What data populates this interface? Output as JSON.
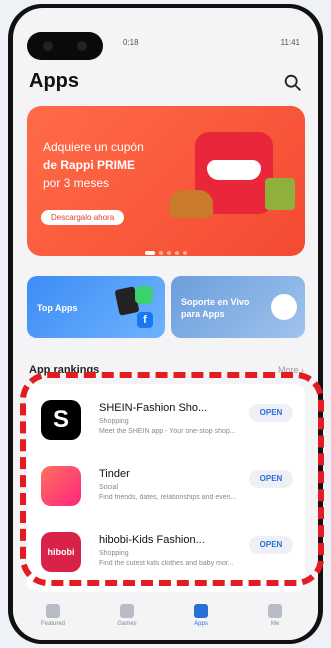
{
  "status": {
    "time_left": "0:18",
    "right": "11:41"
  },
  "header": {
    "title": "Apps"
  },
  "banner": {
    "line1": "Adquiere un cupón",
    "line2": "de Rappi PRIME",
    "line3": "por 3 meses",
    "cta": "Descargalo ahora"
  },
  "cards": [
    {
      "label": "Top Apps"
    },
    {
      "label": "Soporte en Vivo para Apps"
    }
  ],
  "rankings": {
    "title": "App rankings",
    "more": "More ›",
    "items": [
      {
        "name": "SHEIN-Fashion Sho...",
        "category": "Shopping",
        "desc": "Meet the SHEIN app - Your one-stop shop...",
        "action": "OPEN",
        "icon": "shein-icon",
        "letter": "S"
      },
      {
        "name": "Tinder",
        "category": "Social",
        "desc": "Find friends, dates, relationships and even...",
        "action": "OPEN",
        "icon": "tinder-icon",
        "letter": ""
      },
      {
        "name": "hibobi-Kids Fashion...",
        "category": "Shopping",
        "desc": "Find the cutest kids clothes and baby mor...",
        "action": "OPEN",
        "icon": "hibobi-icon",
        "letter": "hibobi"
      }
    ]
  },
  "tabs": [
    {
      "label": "Featured",
      "icon": "featured-icon"
    },
    {
      "label": "Games",
      "icon": "games-icon"
    },
    {
      "label": "Apps",
      "icon": "apps-icon"
    },
    {
      "label": "Me",
      "icon": "me-icon"
    }
  ],
  "colors": {
    "accent": "#2a6fd8",
    "banner": "#f44a32",
    "highlight": "#e31b23"
  }
}
